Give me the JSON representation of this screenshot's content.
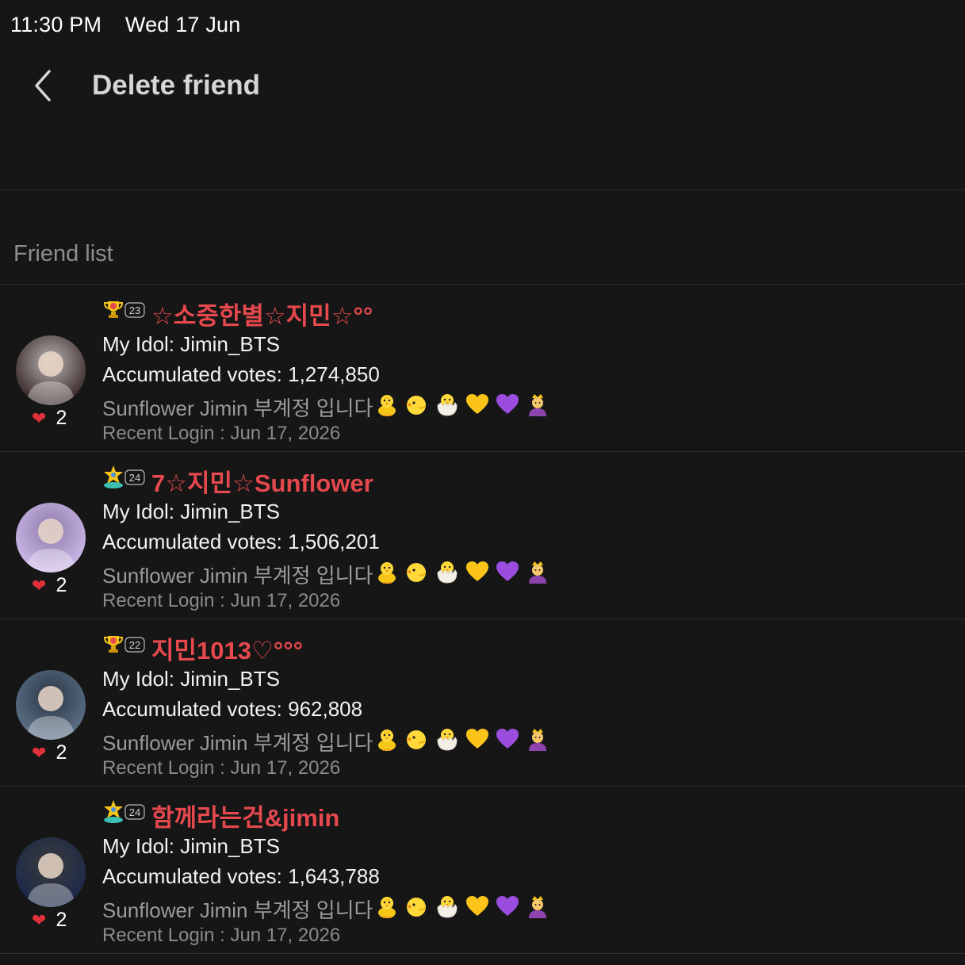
{
  "status_bar": {
    "time": "11:30 PM",
    "date": "Wed 17 Jun"
  },
  "header": {
    "title": "Delete friend"
  },
  "section": {
    "title": "Friend list"
  },
  "friends": [
    {
      "level": "23",
      "badge_icon": "trophy-badge",
      "nickname": "☆소중한별☆지민☆°°",
      "idol": "My Idol: Jimin_BTS",
      "votes": "Accumulated votes: 1,274,850",
      "bio": "Sunflower Jimin 부계정 입니다",
      "login": "Recent Login : Jun 17, 2026",
      "likes": "2",
      "avatar_colors": [
        "#3b2b2b",
        "#b9b6b4"
      ]
    },
    {
      "level": "24",
      "badge_icon": "star-badge",
      "nickname": "7☆지민☆Sunflower",
      "idol": "My Idol: Jimin_BTS",
      "votes": "Accumulated votes: 1,506,201",
      "bio": "Sunflower Jimin 부계정 입니다",
      "login": "Recent Login : Jun 17, 2026",
      "likes": "2",
      "avatar_colors": [
        "#cbb7e8",
        "#8c7aa8"
      ]
    },
    {
      "level": "22",
      "badge_icon": "trophy-badge",
      "nickname": "지민1013♡°°°",
      "idol": "My Idol: Jimin_BTS",
      "votes": "Accumulated votes: 962,808",
      "bio": "Sunflower Jimin 부계정 입니다",
      "login": "Recent Login : Jun 17, 2026",
      "likes": "2",
      "avatar_colors": [
        "#5a6f86",
        "#2a3542"
      ]
    },
    {
      "level": "24",
      "badge_icon": "star-badge",
      "nickname": "함께라는건&jimin",
      "idol": "My Idol: Jimin_BTS",
      "votes": "Accumulated votes: 1,643,788",
      "bio": "Sunflower Jimin 부계정 입니다",
      "login": "Recent Login : Jun 17, 2026",
      "likes": "2",
      "avatar_colors": [
        "#1c2a4a",
        "#3a3a3a"
      ]
    }
  ],
  "bio_emojis": [
    "front-facing-chick-icon",
    "baby-chick-icon",
    "hatching-chick-icon",
    "yellow-heart-icon",
    "purple-heart-icon",
    "person-with-crown-icon"
  ],
  "colors": {
    "accent": "#e5484d",
    "background": "#161616",
    "heart": "#e0303a"
  }
}
